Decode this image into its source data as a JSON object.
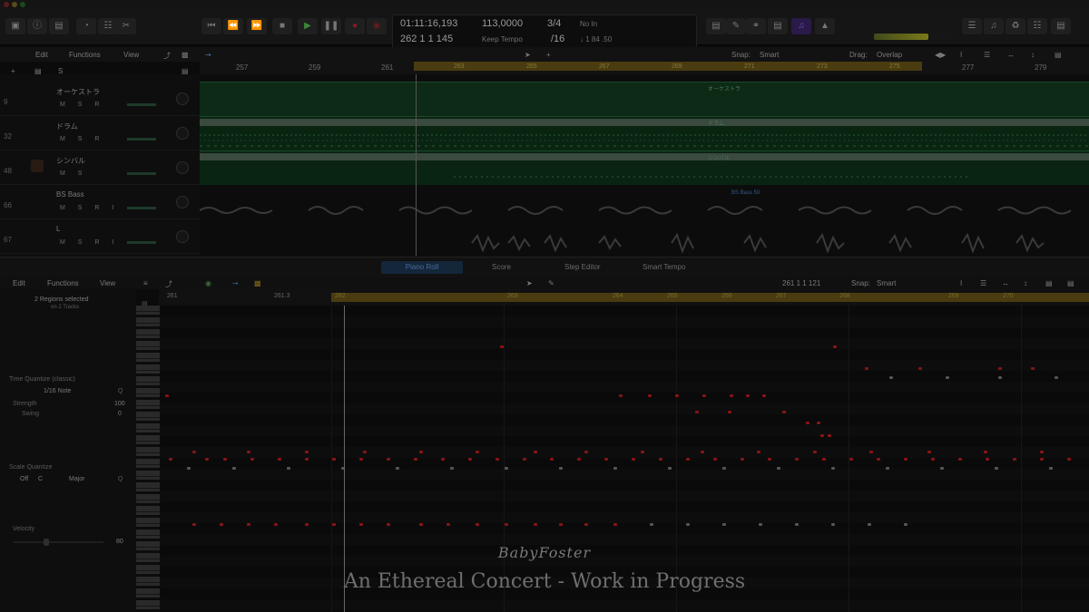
{
  "transport": {
    "timecode": "01:11:16,193",
    "position": "262  1  1  145",
    "tempo": "113,0000",
    "tempo_mode": "Keep Tempo",
    "signature": "3/4",
    "division": "/16",
    "in_label": "No In",
    "out_label": "↓ 1 84 .50"
  },
  "main_menu": {
    "edit": "Edit",
    "functions": "Functions",
    "view": "View",
    "snap_label": "Snap:",
    "snap_value": "Smart",
    "drag_label": "Drag:",
    "drag_value": "Overlap"
  },
  "ruler": {
    "marks": [
      "257",
      "259",
      "261",
      "277",
      "279"
    ],
    "cycle_marks": [
      "263",
      "265",
      "267",
      "269",
      "271",
      "273",
      "275"
    ]
  },
  "tracks": [
    {
      "number": "9",
      "name": "オーケストラ",
      "ms": "M S R"
    },
    {
      "number": "32",
      "name": "ドラム",
      "ms": "M S R"
    },
    {
      "number": "48",
      "name": "シンバル",
      "ms": "M S"
    },
    {
      "number": "66",
      "name": "BS Bass",
      "ms": "M S R I"
    },
    {
      "number": "67",
      "name": "L",
      "ms": "M S R I"
    }
  ],
  "regions": {
    "orchestra": "オーケストラ",
    "drum": "ドラム",
    "cymbal": "シンバル",
    "bass": "BS Bass 50"
  },
  "editor_tabs": [
    "Piano Roll",
    "Score",
    "Step Editor",
    "Smart Tempo"
  ],
  "pr_menu": {
    "edit": "Edit",
    "functions": "Functions",
    "view": "View",
    "position": "261 1 1 121",
    "snap_label": "Snap:",
    "snap_value": "Smart"
  },
  "pr_ruler": {
    "marks": [
      "261",
      "261.3",
      "262",
      "263",
      "264",
      "265",
      "266",
      "267",
      "268",
      "269",
      "270"
    ]
  },
  "inspector": {
    "regions_selected": "2 Regions selected",
    "regions_sub": "on 2 Tracks",
    "time_quantize": "Time Quantize (classic)",
    "note_value": "1/16 Note",
    "strength_label": "Strength",
    "strength_value": "100",
    "swing_label": "Swing",
    "swing_value": "0",
    "scale_quantize": "Scale Quantize",
    "scale_off": "Off",
    "scale_root": "C",
    "scale_mode": "Major",
    "velocity_label": "Velocity",
    "velocity_value": "80"
  },
  "watermark": {
    "brand": "BabyFoster",
    "title": "An Ethereal Concert - Work in Progress"
  },
  "colors": {
    "region_green": "#0c2a16",
    "cycle_yellow": "#4a3c10",
    "note_red": "#8a1414",
    "note_gray": "#555555",
    "record_red": "#8a1a1a",
    "play_green": "#2a6a2a"
  }
}
